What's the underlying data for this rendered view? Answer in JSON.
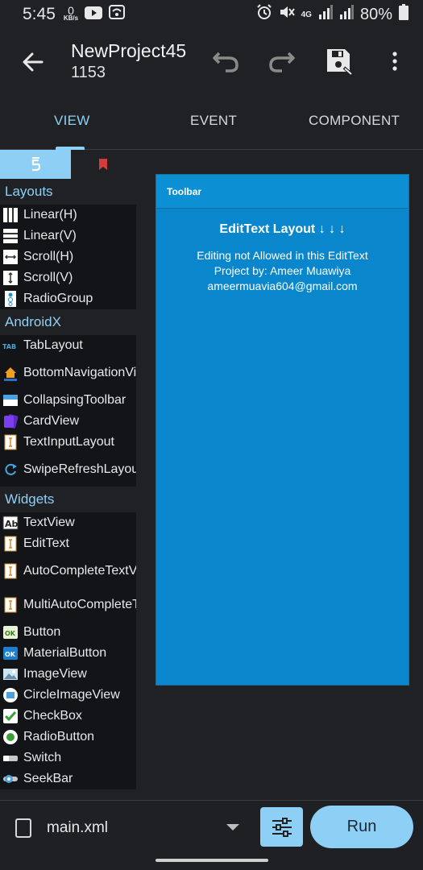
{
  "status_bar": {
    "time": "5:45",
    "kbs_value": "0",
    "kbs_unit": "KB/s",
    "battery": "80%",
    "network": "4G"
  },
  "app_bar": {
    "title": "NewProject45",
    "subtitle": "1153"
  },
  "tabs": [
    {
      "label": "VIEW",
      "active": true
    },
    {
      "label": "EVENT",
      "active": false
    },
    {
      "label": "COMPONENT",
      "active": false
    }
  ],
  "palette": {
    "sections": [
      {
        "title": "Layouts",
        "items": [
          {
            "label": "Linear(H)",
            "icon": "linear-h-icon"
          },
          {
            "label": "Linear(V)",
            "icon": "linear-v-icon"
          },
          {
            "label": "Scroll(H)",
            "icon": "scroll-h-icon"
          },
          {
            "label": "Scroll(V)",
            "icon": "scroll-v-icon"
          },
          {
            "label": "RadioGroup",
            "icon": "radiogroup-icon"
          }
        ]
      },
      {
        "title": "AndroidX",
        "items": [
          {
            "label": "TabLayout",
            "icon": "tablayout-icon"
          },
          {
            "label": "BottomNavigationView",
            "icon": "bottomnav-icon"
          },
          {
            "label": "CollapsingToolbar",
            "icon": "collapsing-toolbar-icon"
          },
          {
            "label": "CardView",
            "icon": "cardview-icon"
          },
          {
            "label": "TextInputLayout",
            "icon": "textinput-icon"
          },
          {
            "label": "SwipeRefreshLayout",
            "icon": "swiperefresh-icon"
          }
        ]
      },
      {
        "title": "Widgets",
        "items": [
          {
            "label": "TextView",
            "icon": "textview-icon"
          },
          {
            "label": "EditText",
            "icon": "edittext-icon"
          },
          {
            "label": "AutoCompleteTextView",
            "icon": "autocomplete-icon"
          },
          {
            "label": "MultiAutoCompleteTextView",
            "icon": "multiautocomplete-icon"
          },
          {
            "label": "Button",
            "icon": "button-icon"
          },
          {
            "label": "MaterialButton",
            "icon": "materialbutton-icon"
          },
          {
            "label": "ImageView",
            "icon": "imageview-icon"
          },
          {
            "label": "CircleImageView",
            "icon": "circleimageview-icon"
          },
          {
            "label": "CheckBox",
            "icon": "checkbox-icon"
          },
          {
            "label": "RadioButton",
            "icon": "radiobutton-icon"
          },
          {
            "label": "Switch",
            "icon": "switch-icon"
          },
          {
            "label": "SeekBar",
            "icon": "seekbar-icon"
          }
        ]
      }
    ]
  },
  "preview": {
    "toolbar_label": "Toolbar",
    "heading": "EditText Layout ↓ ↓ ↓",
    "line1": "Editing not Allowed in this EditText",
    "line2": "Project by: Ameer Muawiya",
    "line3": "ameermuavia604@gmail.com"
  },
  "bottom_bar": {
    "file_name": "main.xml",
    "run_label": "Run"
  },
  "colors": {
    "accent": "#8ecff5",
    "preview_bg": "#0a87cc",
    "background": "#202124"
  }
}
